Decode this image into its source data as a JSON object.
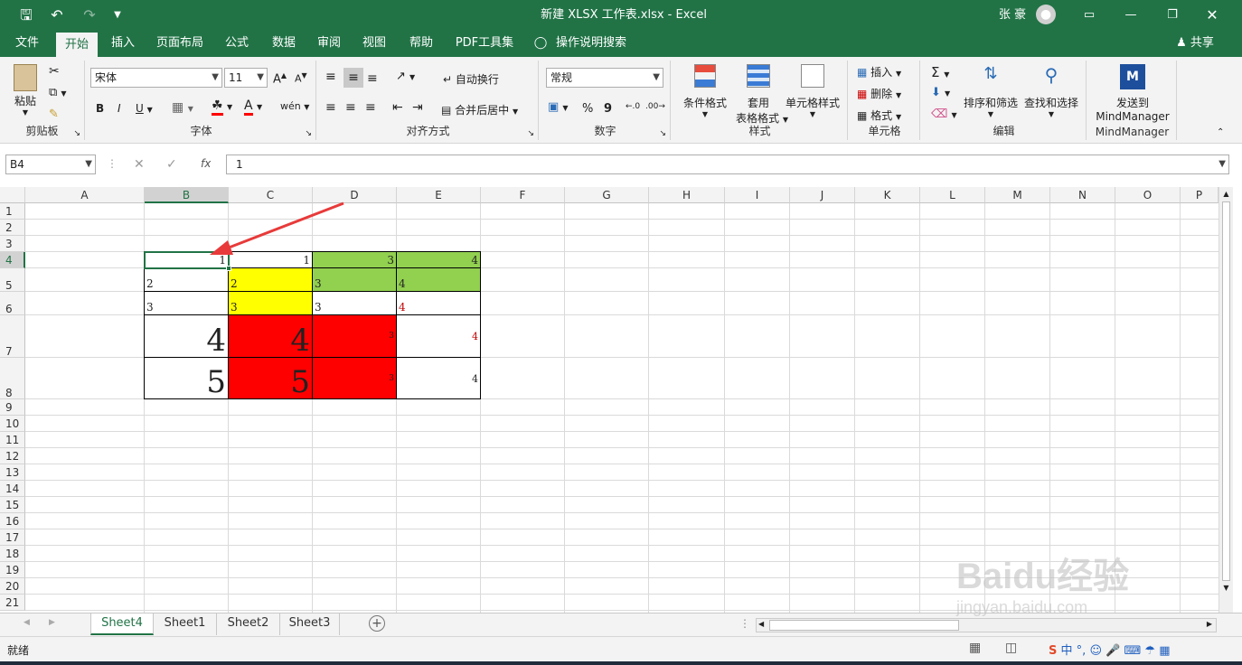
{
  "window": {
    "title": "新建 XLSX 工作表.xlsx  -  Excel",
    "user": "张 豪"
  },
  "menu": {
    "items": [
      "文件",
      "开始",
      "插入",
      "页面布局",
      "公式",
      "数据",
      "审阅",
      "视图",
      "帮助",
      "PDF工具集"
    ],
    "search": "操作说明搜索",
    "share": "共享"
  },
  "ribbon": {
    "clipboard": {
      "paste": "粘贴",
      "label": "剪贴板"
    },
    "font": {
      "name": "宋体",
      "size": "11",
      "bold": "B",
      "italic": "I",
      "underline": "U",
      "label": "字体"
    },
    "align": {
      "wrap": "自动换行",
      "merge": "合并后居中",
      "label": "对齐方式"
    },
    "number": {
      "format": "常规",
      "percent": "%",
      "comma": "9",
      "label": "数字"
    },
    "styles": {
      "cond": "条件格式",
      "table1": "套用",
      "table2": "表格格式",
      "cellstyle": "单元格样式",
      "label": "样式"
    },
    "cells": {
      "insert": "插入",
      "delete": "删除",
      "format": "格式",
      "label": "单元格"
    },
    "editing": {
      "sort": "排序和筛选",
      "find": "查找和选择",
      "label": "编辑"
    },
    "mindmanager": {
      "send1": "发送到",
      "send2": "MindManager",
      "label": "MindManager"
    }
  },
  "formula": {
    "namebox": "B4",
    "fx": "fx",
    "value": "1"
  },
  "grid": {
    "columns": [
      "A",
      "B",
      "C",
      "D",
      "E",
      "F",
      "G",
      "H",
      "I",
      "J",
      "K",
      "L",
      "M",
      "N",
      "O",
      "P"
    ],
    "rows": [
      "1",
      "2",
      "3",
      "4",
      "5",
      "6",
      "7",
      "8",
      "9",
      "10",
      "11",
      "12",
      "13",
      "14",
      "15",
      "16",
      "17",
      "18",
      "19",
      "20",
      "21"
    ],
    "cells": {
      "B4": "1",
      "C4": "1",
      "D4": "3",
      "E4": "4",
      "B5": "2",
      "C5": "2",
      "D5": "3",
      "E5": "4",
      "B6": "3",
      "C6": "3",
      "D6": "3",
      "E6": "4",
      "B7": "4",
      "C7": "4",
      "D7": "3",
      "E7": "4",
      "B8": "5",
      "C8": "5",
      "D8": "3",
      "E8": "4"
    },
    "colors": {
      "green": "#92d050",
      "yellow": "#ffff00",
      "red": "#ff0000",
      "redtext": "#c00000"
    }
  },
  "sheets": [
    "Sheet4",
    "Sheet1",
    "Sheet2",
    "Sheet3"
  ],
  "status": {
    "ready": "就绪"
  },
  "watermark": {
    "text": "Baidu经验",
    "url": "jingyan.baidu.com"
  }
}
